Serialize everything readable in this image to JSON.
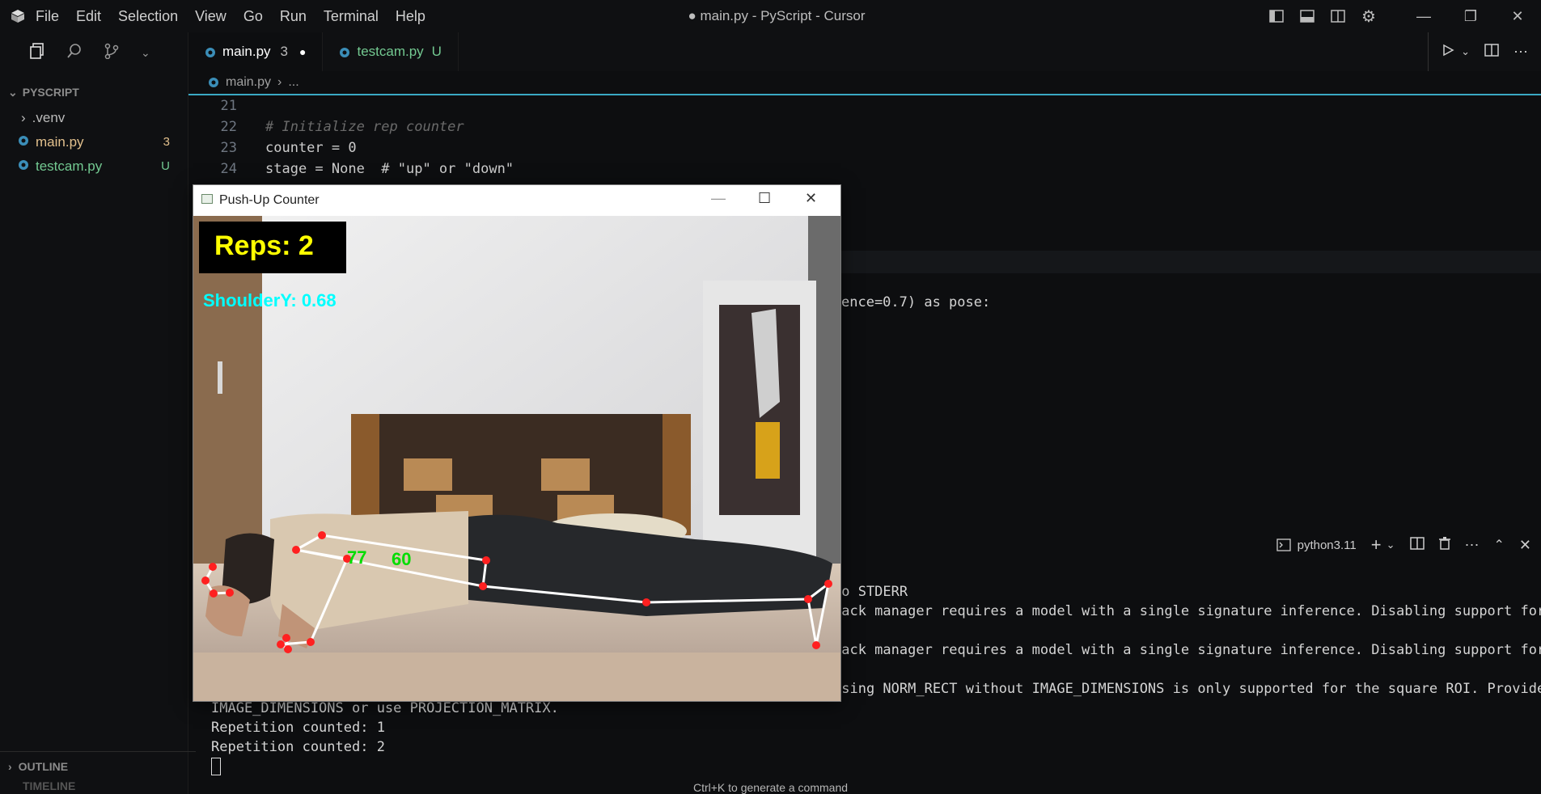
{
  "titlebar": {
    "menu": [
      "File",
      "Edit",
      "Selection",
      "View",
      "Go",
      "Run",
      "Terminal",
      "Help"
    ],
    "title": "● main.py - PyScript - Cursor"
  },
  "sidebar": {
    "project": "PYSCRIPT",
    "files": [
      {
        "name": ".venv",
        "badge": ""
      },
      {
        "name": "main.py",
        "badge": "3"
      },
      {
        "name": "testcam.py",
        "badge": "U"
      }
    ],
    "outline": "OUTLINE",
    "timeline": "TIMELINE"
  },
  "tabs": [
    {
      "name": "main.py",
      "badge": "3"
    },
    {
      "name": "testcam.py",
      "badge": "U"
    }
  ],
  "breadcrumb": {
    "file": "main.py",
    "rest": "..."
  },
  "code": {
    "lines": [
      {
        "n": "21",
        "text": ""
      },
      {
        "n": "22",
        "text": "# Initialize rep counter"
      },
      {
        "n": "23",
        "text": "counter = 0"
      },
      {
        "n": "24",
        "text": "stage = None  # \"up\" or \"down\""
      }
    ],
    "partial": "ence=0.7) as pose:"
  },
  "panel": {
    "terminal_name": "python3.11"
  },
  "terminal": {
    "lines": [
      "to STDERR",
      "back manager requires a model with a single signature inference. Disabling support for",
      "",
      "back manager requires a model with a single signature inference. Disabling support for",
      "",
      "Using NORM_RECT without IMAGE_DIMENSIONS is only supported for the square ROI. Provide",
      "IMAGE_DIMENSIONS or use PROJECTION_MATRIX.",
      "Repetition counted: 1",
      "Repetition counted: 2"
    ]
  },
  "status": {
    "hint": "Ctrl+K to generate a command"
  },
  "cvwindow": {
    "title": "Push-Up Counter",
    "reps": "Reps: 2",
    "shoulder": "ShoulderY: 0.68",
    "angles": [
      "77",
      "60"
    ]
  },
  "colors": {
    "accent": "#3aa9c4",
    "file_modified": "#e2c08d",
    "file_untracked": "#73c991",
    "skeleton": "#ff2020",
    "reps_text": "#ffff00",
    "shoulder_text": "#00ffff",
    "angle_text": "#00dd00"
  }
}
